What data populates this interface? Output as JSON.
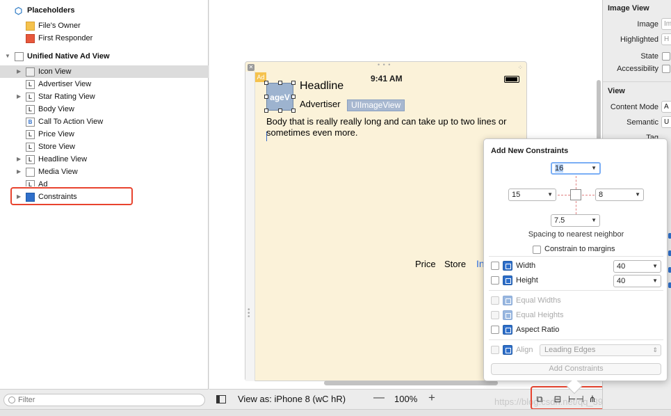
{
  "outline": {
    "placeholders": "Placeholders",
    "files_owner": "File's Owner",
    "first_responder": "First Responder",
    "root": "Unified Native Ad View",
    "items": [
      {
        "label": "Icon View",
        "icon": "L"
      },
      {
        "label": "Advertiser View",
        "icon": "L"
      },
      {
        "label": "Star Rating View",
        "icon": "L"
      },
      {
        "label": "Body View",
        "icon": "L"
      },
      {
        "label": "Call To Action View",
        "icon": "B"
      },
      {
        "label": "Price View",
        "icon": "L"
      },
      {
        "label": "Store View",
        "icon": "L"
      },
      {
        "label": "Headline View",
        "icon": "L"
      },
      {
        "label": "Media View",
        "icon": ""
      },
      {
        "label": "Ad",
        "icon": "L"
      },
      {
        "label": "Constraints",
        "icon": ""
      }
    ],
    "filter_placeholder": "Filter"
  },
  "canvas": {
    "status_time": "9:41 AM",
    "ad_badge": "Ad",
    "icon_image_text": "ageV",
    "headline": "Headline",
    "advertiser": "Advertiser",
    "uiimageview_tag": "UIImageView",
    "body": "Body that is really really long and can take up to two lines or sometimes even more.",
    "price": "Price",
    "store": "Store",
    "install": "In"
  },
  "bottom_bar": {
    "view_as": "View as: iPhone 8 (wC hR)",
    "zoom_out": "—",
    "zoom": "100%",
    "zoom_in": "+",
    "watermark": "https://blog.csdn.net/qq_39108767"
  },
  "inspector": {
    "image_view_header": "Image View",
    "image_label": "Image",
    "image_placeholder": "Im",
    "highlighted_label": "Highlighted",
    "highlighted_placeholder": "H",
    "state_label": "State",
    "accessibility_label": "Accessibility",
    "view_header": "View",
    "content_mode_label": "Content Mode",
    "content_mode_value": "A",
    "semantic_label": "Semantic",
    "semantic_value": "U",
    "tag_label": "Tag"
  },
  "popover": {
    "title": "Add New Constraints",
    "top_value": "16",
    "left_value": "15",
    "right_value": "8",
    "bottom_value": "7.5",
    "spacing_text": "Spacing to nearest neighbor",
    "constrain_margins": "Constrain to margins",
    "width_label": "Width",
    "width_value": "40",
    "height_label": "Height",
    "height_value": "40",
    "equal_widths": "Equal Widths",
    "equal_heights": "Equal Heights",
    "aspect_ratio": "Aspect Ratio",
    "align_label": "Align",
    "align_value": "Leading Edges",
    "add_button": "Add Constraints"
  },
  "colors": {
    "highlight": "#e8432e",
    "accent": "#2f6fca",
    "scene_bg": "#fbf2d9"
  }
}
